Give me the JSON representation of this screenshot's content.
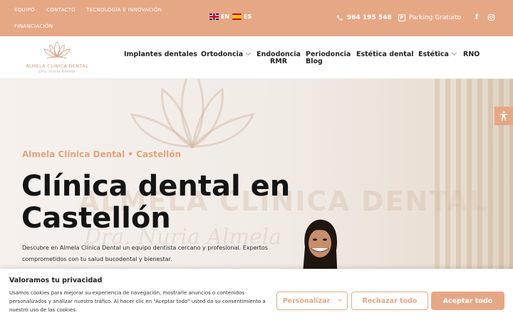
{
  "colors": {
    "brand": "#e6a785",
    "text": "#141414",
    "subtitle": "#e3a27e"
  },
  "topbar": {
    "links": [
      "EQUIPO",
      "CONTACTO",
      "TECNOLOGÍA E INNOVACIÓN",
      "FINANCIACIÓN"
    ],
    "lang_en": "EN",
    "lang_es": "ES",
    "phone": "964 195 548",
    "parking": "Parking Gratuito",
    "parking_icon_letter": "P"
  },
  "logo": {
    "name": "ALMELA CLÍNICA DENTAL",
    "signature": "Dra. Nuria Almela"
  },
  "nav": {
    "implantes": "Implantes dentales",
    "ortodoncia": "Ortodoncia",
    "endodoncia_1": "Endodoncia",
    "endodoncia_2": "RMR",
    "periodoncia_1": "Periodoncia",
    "periodoncia_2": "Blog",
    "estetica_dental": "Estética dental",
    "estetica": "Estética",
    "rno": "RNO"
  },
  "hero": {
    "subtitle": "Almela Clínica Dental • Castellón",
    "headline": "Clínica dental en Castellón",
    "description": "Descubre en Almela Clínica Dental un equipo dentista cercano y profesional. Expertos comprometidos con tu salud bucodental y bienestar.",
    "bg_text": "ALMELA CLÍNICA DENTAL",
    "bg_signature": "Dra. Nuria Almela"
  },
  "cookie": {
    "title": "Valoramos tu privacidad",
    "text": "Usamos cookies para mejorar su experiencia de navegación, mostrarle anuncios o contenidos personalizados y analizar nuestro tráfico. Al hacer clic en “Aceptar todo” usted da su consentimiento a nuestro uso de las cookies.",
    "customize": "Personalizar",
    "reject": "Rechazar todo",
    "accept": "Aceptar todo"
  }
}
